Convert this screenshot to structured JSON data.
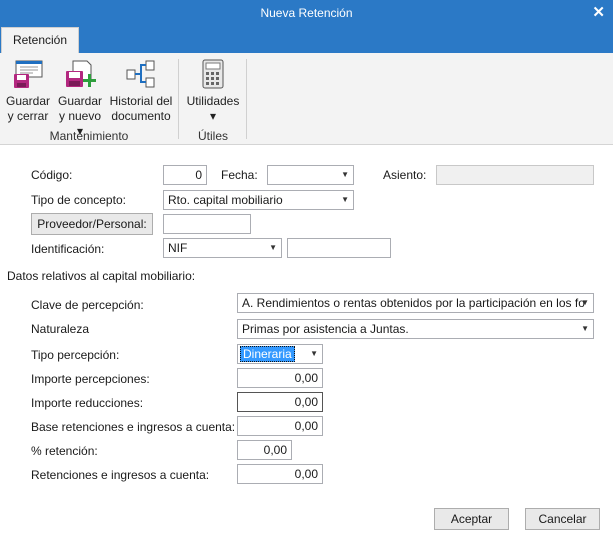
{
  "window": {
    "title": "Nueva Retención"
  },
  "tabs": [
    {
      "label": "Retención"
    }
  ],
  "ribbon": {
    "save_close": {
      "line1": "Guardar",
      "line2": "y cerrar"
    },
    "save_new": {
      "line1": "Guardar",
      "line2": "y nuevo ▾"
    },
    "history": {
      "line1": "Historial del",
      "line2": "documento"
    },
    "utilities": {
      "line1": "Utilidades",
      "line2": "▾"
    },
    "group_mantenimiento": "Mantenimiento",
    "group_utiles": "Útiles"
  },
  "form": {
    "codigo": {
      "label": "Código:",
      "value": "0"
    },
    "fecha": {
      "label": "Fecha:",
      "value": ""
    },
    "asiento": {
      "label": "Asiento:",
      "value": ""
    },
    "tipo_concepto": {
      "label": "Tipo de concepto:",
      "value": "Rto. capital mobiliario"
    },
    "proveedor": {
      "button": "Proveedor/Personal:",
      "value": ""
    },
    "identificacion": {
      "label": "Identificación:",
      "type": "NIF",
      "value": ""
    },
    "section_title": "Datos relativos al capital mobiliario:",
    "clave": {
      "label": "Clave de percepción:",
      "value": "A. Rendimientos o rentas obtenidos por la participación en los fo"
    },
    "naturaleza": {
      "label": "Naturaleza",
      "value": "Primas por asistencia a Juntas."
    },
    "tipo_percepcion": {
      "label": "Tipo percepción:",
      "value": "Dineraria"
    },
    "importe_percepciones": {
      "label": "Importe percepciones:",
      "value": "0,00"
    },
    "importe_reducciones": {
      "label": "Importe reducciones:",
      "value": "0,00"
    },
    "base_retenciones": {
      "label": "Base retenciones e ingresos a cuenta:",
      "value": "0,00"
    },
    "pct_retencion": {
      "label": "% retención:",
      "value": "0,00"
    },
    "retenciones": {
      "label": "Retenciones e ingresos a cuenta:",
      "value": "0,00"
    }
  },
  "footer": {
    "accept": "Aceptar",
    "cancel": "Cancelar"
  },
  "colors": {
    "titlebar": "#2b79c6",
    "accent_magenta": "#b3277f",
    "accent_green": "#2e9e3d",
    "accent_blue": "#1f6fc0"
  }
}
